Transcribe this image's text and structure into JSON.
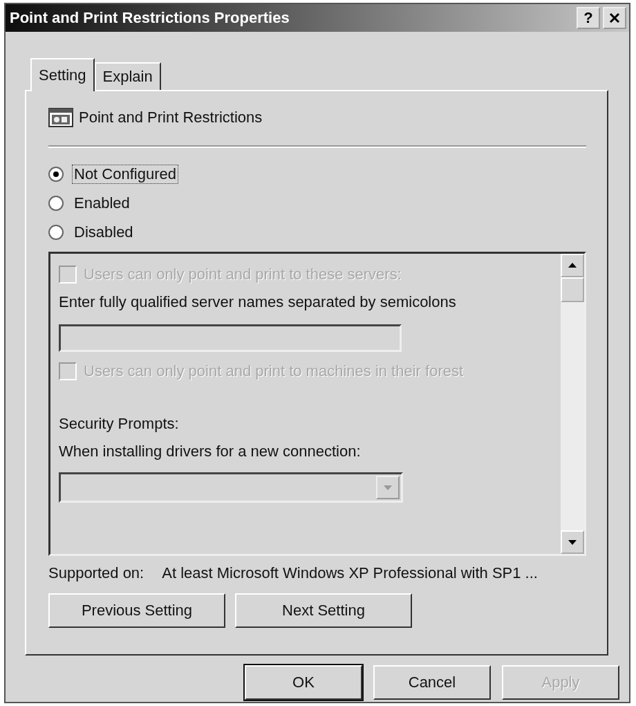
{
  "window": {
    "title": "Point and Print Restrictions Properties",
    "help": "?"
  },
  "tabs": [
    {
      "label": "Setting",
      "selected": true
    },
    {
      "label": "Explain",
      "selected": false
    }
  ],
  "policy": {
    "name": "Point and Print Restrictions"
  },
  "options": [
    {
      "label": "Not Configured",
      "selected": true
    },
    {
      "label": "Enabled",
      "selected": false
    },
    {
      "label": "Disabled",
      "selected": false
    }
  ],
  "settings_panel": [
    {
      "kind": "checkbox",
      "label": "Users can only point and print to these servers:",
      "checked": false,
      "disabled": true
    },
    {
      "kind": "label",
      "label": "Enter fully qualified server names separated by semicolons"
    },
    {
      "kind": "field",
      "disabled": true
    },
    {
      "kind": "checkbox",
      "label": "Users can only point and print to machines in their forest",
      "checked": false,
      "disabled": true
    },
    {
      "kind": "label",
      "label": "Security Prompts:"
    },
    {
      "kind": "label",
      "label": "When installing drivers for a new connection:"
    },
    {
      "kind": "dropdown",
      "disabled": true
    }
  ],
  "supported": {
    "label": "Supported on:",
    "value": "At least Microsoft Windows XP Professional with SP1 ..."
  },
  "nav_buttons": [
    "Previous Setting",
    "Next Setting"
  ],
  "buttons": [
    {
      "label": "OK",
      "default": true,
      "disabled": false
    },
    {
      "label": "Cancel",
      "default": false,
      "disabled": false
    },
    {
      "label": "Apply",
      "default": false,
      "disabled": true
    }
  ]
}
